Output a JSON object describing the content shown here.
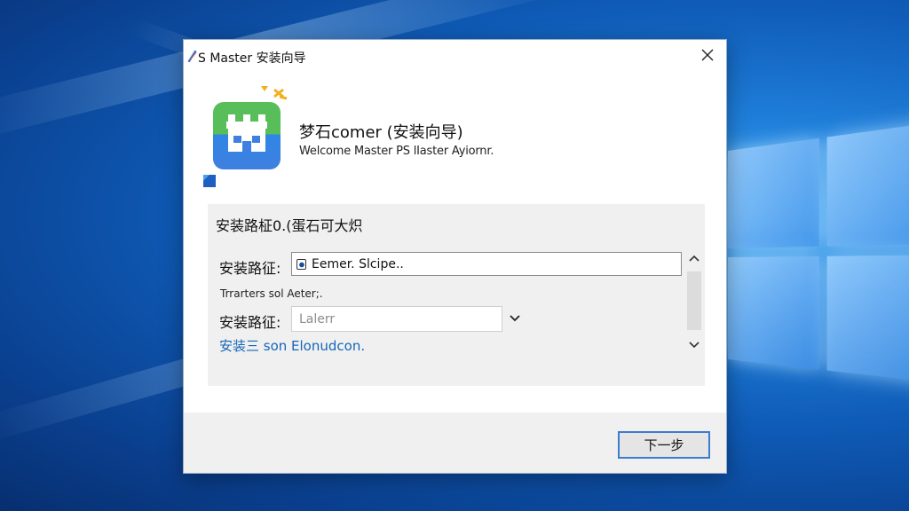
{
  "window": {
    "title": "S Master 安装向导"
  },
  "header": {
    "heading": "梦石comer (安装向导)",
    "subheading": "Welcome Master PS lIaster Ayiornr."
  },
  "panel": {
    "title": "安装路柾0.(蛋石可大炽",
    "path_label": "安装路征:",
    "path_value": "Eemer. Slcipe..",
    "note": "Trrarters sol Aeter;.",
    "type_label": "安装路征:",
    "type_placeholder": "Lalerr",
    "link": "安装三 son Elonudcon."
  },
  "footer": {
    "next_label": "下一步"
  },
  "icons": [
    "windows-logo",
    "app-icon",
    "close-icon",
    "sparkle-icon",
    "chevron-down-icon",
    "chevron-up-icon",
    "file-icon"
  ],
  "colors": {
    "desktop_blue": "#0f5cb8",
    "app_green": "#58be5a",
    "app_blue": "#2f86e4",
    "link_blue": "#1566b8",
    "button_border": "#3c7bd0"
  }
}
